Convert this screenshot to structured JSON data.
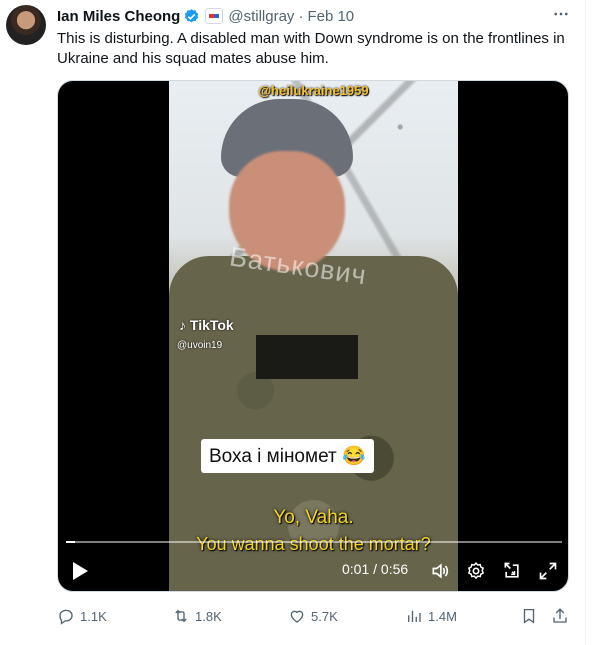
{
  "tweet": {
    "author_name": "Ian Miles Cheong",
    "handle": "@stillgray",
    "separator": "·",
    "date": "Feb 10",
    "text": "This is disturbing. A disabled man with Down syndrome is on the frontlines in Ukraine and his squad mates abuse him."
  },
  "video": {
    "top_tag": "@heilukraine1959",
    "watermark": "Батькович",
    "tiktok_label": "TikTok",
    "tiktok_user": "@uvoin19",
    "caption": "Воха і міномет 😂",
    "subtitle_line1": "Yo, Vaha.",
    "subtitle_line2": "You wanna shoot the mortar?",
    "current_time": "0:01",
    "time_separator": " / ",
    "duration": "0:56",
    "progress_fraction": 0.0178
  },
  "actions": {
    "replies": "1.1K",
    "reposts": "1.8K",
    "likes": "5.7K",
    "views": "1.4M"
  },
  "colors": {
    "text": "#0f1419",
    "secondary": "#536471",
    "verified": "#1d9bf0",
    "subtitle": "#f5d426"
  }
}
